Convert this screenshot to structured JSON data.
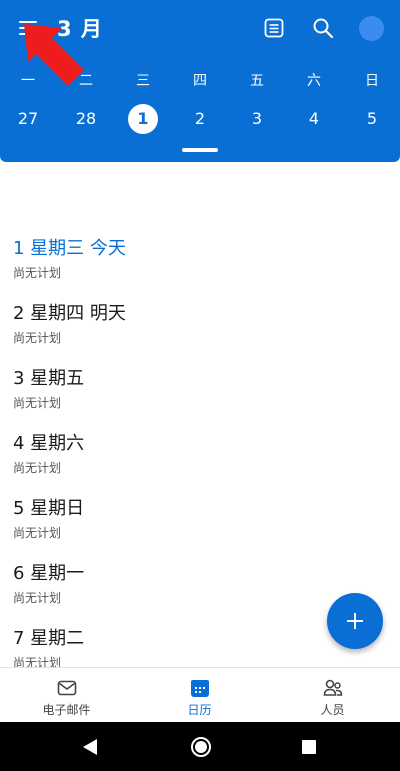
{
  "header": {
    "month_title": "3 月",
    "weekdays": [
      "一",
      "二",
      "三",
      "四",
      "五",
      "六",
      "日"
    ],
    "dates": [
      "27",
      "28",
      "1",
      "2",
      "3",
      "4",
      "5"
    ],
    "selected_date": "1",
    "icons": [
      "menu-icon",
      "agenda-view-icon",
      "search-icon",
      "avatar"
    ]
  },
  "agenda": {
    "days": [
      {
        "title": "1 星期三  今天",
        "sub": "尚无计划",
        "today": true
      },
      {
        "title": "2 星期四  明天",
        "sub": "尚无计划",
        "today": false
      },
      {
        "title": "3 星期五",
        "sub": "尚无计划",
        "today": false
      },
      {
        "title": "4 星期六",
        "sub": "尚无计划",
        "today": false
      },
      {
        "title": "5 星期日",
        "sub": "尚无计划",
        "today": false
      },
      {
        "title": "6 星期一",
        "sub": "尚无计划",
        "today": false
      },
      {
        "title": "7 星期二",
        "sub": "尚无计划",
        "today": false
      }
    ]
  },
  "bottom_nav": {
    "mail_label": "电子邮件",
    "calendar_label": "日历",
    "people_label": "人员"
  },
  "colors": {
    "accent": "#0a6fd4",
    "annotation_arrow": "#ee1c1c"
  }
}
